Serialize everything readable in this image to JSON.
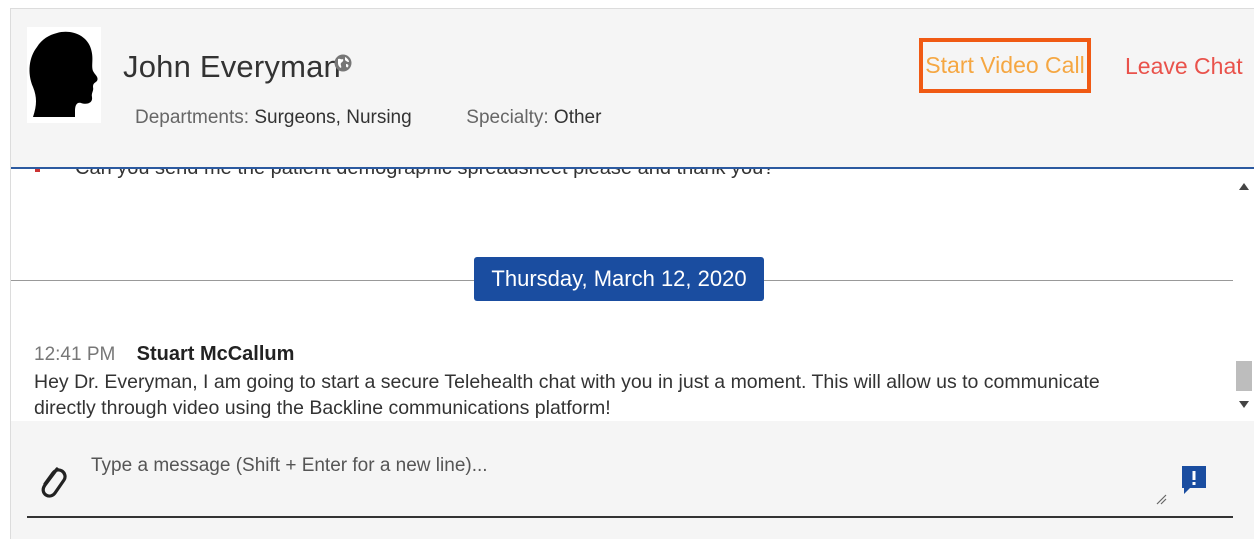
{
  "contact": {
    "name": "John Everyman",
    "avatar_icon": "person-silhouette-icon",
    "status_icon": "globe-icon",
    "departments_label": "Departments:",
    "departments_value": "Surgeons, Nursing",
    "specialty_label": "Specialty:",
    "specialty_value": "Other"
  },
  "actions": {
    "video_call_label": "Start Video Call",
    "leave_chat_label": "Leave Chat"
  },
  "messages": {
    "previous_partial": "Can you send me the patient demographic spreadsheet please and thank you?",
    "date_divider": "Thursday, March 12, 2020",
    "items": [
      {
        "time": "12:41 PM",
        "sender": "Stuart McCallum",
        "text": " Hey Dr. Everyman, I am going to start a secure Telehealth chat with you in just a moment. This will allow us to communicate directly through video using the Backline communications platform!"
      }
    ]
  },
  "composer": {
    "placeholder": "Type a message (Shift + Enter for a new line)...",
    "attach_icon": "paperclip-icon",
    "priority_icon": "priority-message-icon"
  },
  "colors": {
    "header_border": "#2c5aa0",
    "video_call_border": "#f05a14",
    "video_call_text": "#f5a742",
    "leave_chat_text": "#e9524b",
    "date_pill_bg": "#1a4da0"
  }
}
